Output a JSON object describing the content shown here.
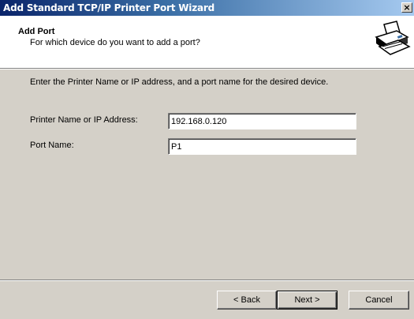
{
  "window": {
    "title": "Add Standard TCP/IP Printer Port Wizard",
    "close_glyph": "×"
  },
  "header": {
    "title": "Add Port",
    "subtitle": "For which device do you want to add a port?",
    "icon": "printer-icon"
  },
  "body": {
    "instruction": "Enter the Printer Name or IP address, and a port name for the desired device.",
    "fields": {
      "printer_label": "Printer Name or IP Address:",
      "printer_value": "192.168.0.120",
      "port_label": "Port Name:",
      "port_value": "P1"
    }
  },
  "buttons": {
    "back": "< Back",
    "next": "Next >",
    "cancel": "Cancel"
  },
  "colors": {
    "titlebar_start": "#0a246a",
    "titlebar_end": "#a6caf0",
    "face": "#d4d0c8"
  }
}
